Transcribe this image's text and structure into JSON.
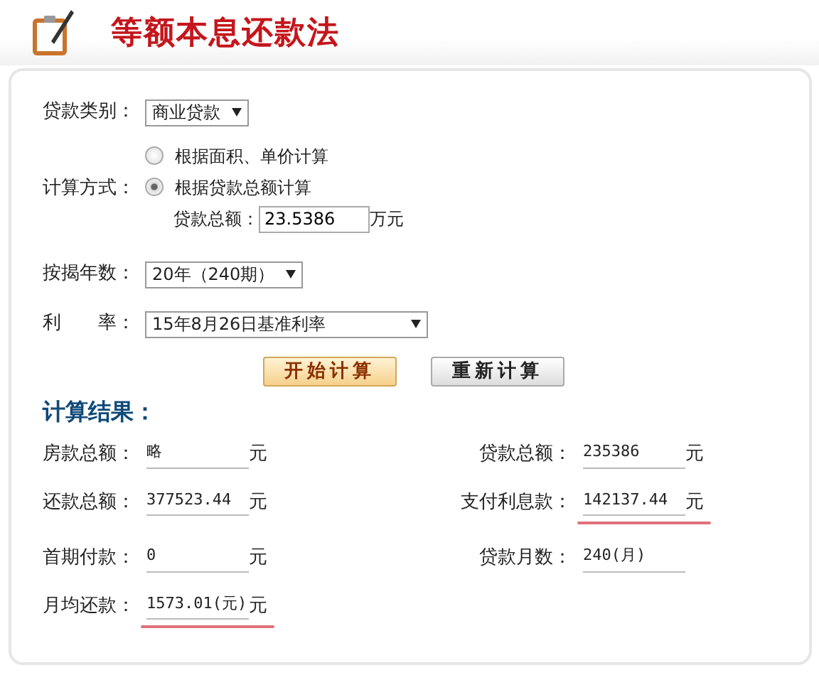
{
  "header": {
    "title": "等额本息还款法"
  },
  "form": {
    "loan_type": {
      "label": "贷款类别：",
      "value": "商业贷款"
    },
    "method": {
      "label": "计算方式：",
      "options": [
        {
          "label": "根据面积、单价计算",
          "selected": false
        },
        {
          "label": "根据贷款总额计算",
          "selected": true
        }
      ],
      "amount": {
        "label": "贷款总额：",
        "value": "23.5386",
        "unit": "万元"
      }
    },
    "years": {
      "label": "按揭年数：",
      "value": "20年（240期）"
    },
    "rate": {
      "label": "利　　率：",
      "value": "15年8月26日基准利率"
    }
  },
  "buttons": [
    {
      "label": "开始计算",
      "kind": "primary"
    },
    {
      "label": "重新计算",
      "kind": "secondary"
    }
  ],
  "results": {
    "title": "计算结果：",
    "items": [
      {
        "label": "房款总额：",
        "value": "略",
        "unit": "元",
        "underlined": false
      },
      {
        "label": "贷款总额：",
        "value": "235386",
        "unit": "元",
        "underlined": false
      },
      {
        "label": "还款总额：",
        "value": "377523.44",
        "unit": "元",
        "underlined": false
      },
      {
        "label": "支付利息款：",
        "value": "142137.44",
        "unit": "元",
        "underlined": true
      },
      {
        "label": "首期付款：",
        "value": "0",
        "unit": "元",
        "underlined": false
      },
      {
        "label": "贷款月数：",
        "value": "240(月)",
        "underlined": false
      },
      {
        "label": "月均还款：",
        "value": "1573.01(元)",
        "unit": "元",
        "underlined": true
      }
    ]
  }
}
